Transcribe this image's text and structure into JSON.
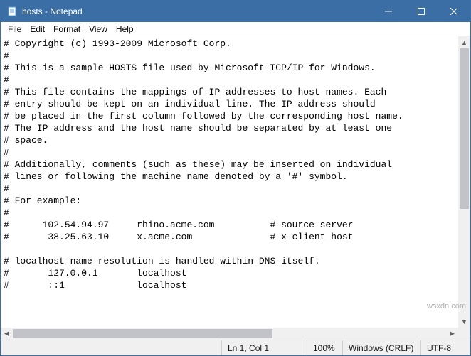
{
  "titlebar": {
    "title": "hosts - Notepad"
  },
  "menu": {
    "file": {
      "u": "F",
      "rest": "ile"
    },
    "edit": {
      "u": "E",
      "rest": "dit"
    },
    "format": {
      "u": "o",
      "pre": "F",
      "rest": "rmat"
    },
    "view": {
      "u": "V",
      "rest": "iew"
    },
    "help": {
      "u": "H",
      "rest": "elp"
    }
  },
  "content_lines": [
    "# Copyright (c) 1993-2009 Microsoft Corp.",
    "#",
    "# This is a sample HOSTS file used by Microsoft TCP/IP for Windows.",
    "#",
    "# This file contains the mappings of IP addresses to host names. Each",
    "# entry should be kept on an individual line. The IP address should",
    "# be placed in the first column followed by the corresponding host name.",
    "# The IP address and the host name should be separated by at least one",
    "# space.",
    "#",
    "# Additionally, comments (such as these) may be inserted on individual",
    "# lines or following the machine name denoted by a '#' symbol.",
    "#",
    "# For example:",
    "#",
    "#      102.54.94.97     rhino.acme.com          # source server",
    "#       38.25.63.10     x.acme.com              # x client host",
    "",
    "# localhost name resolution is handled within DNS itself.",
    "#       127.0.0.1       localhost",
    "#       ::1             localhost"
  ],
  "status": {
    "position": "Ln 1, Col 1",
    "zoom": "100%",
    "line_ending": "Windows (CRLF)",
    "encoding": "UTF-8"
  },
  "watermark": "wsxdn.com"
}
